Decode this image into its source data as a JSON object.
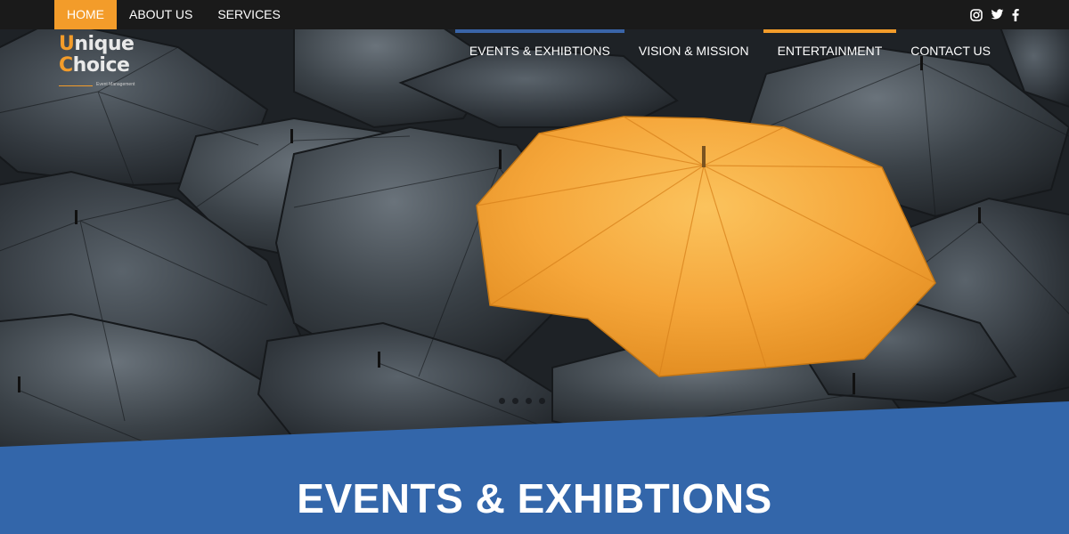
{
  "topnav": {
    "items": [
      {
        "label": "HOME",
        "active": true
      },
      {
        "label": "ABOUT US",
        "active": false
      },
      {
        "label": "SERVICES",
        "active": false
      }
    ]
  },
  "social": {
    "icons": [
      "instagram-icon",
      "twitter-icon",
      "facebook-icon"
    ]
  },
  "logo": {
    "line1": "Unique",
    "line2": "Choice",
    "tagline": "Event Management"
  },
  "mainnav": {
    "items": [
      {
        "label": "EVENTS & EXHIBTIONS",
        "accent": "#3a65a8"
      },
      {
        "label": "VISION & MISSION",
        "accent": ""
      },
      {
        "label": "ENTERTAINMENT",
        "accent": "#f39c2a"
      },
      {
        "label": "CONTACT US",
        "accent": ""
      }
    ]
  },
  "hero": {
    "carousel_dots": 4
  },
  "section": {
    "title": "EVENTS & EXHIBTIONS"
  },
  "colors": {
    "accent_orange": "#f39c2a",
    "accent_blue": "#3366aa",
    "topbar": "#1a1a1a"
  }
}
